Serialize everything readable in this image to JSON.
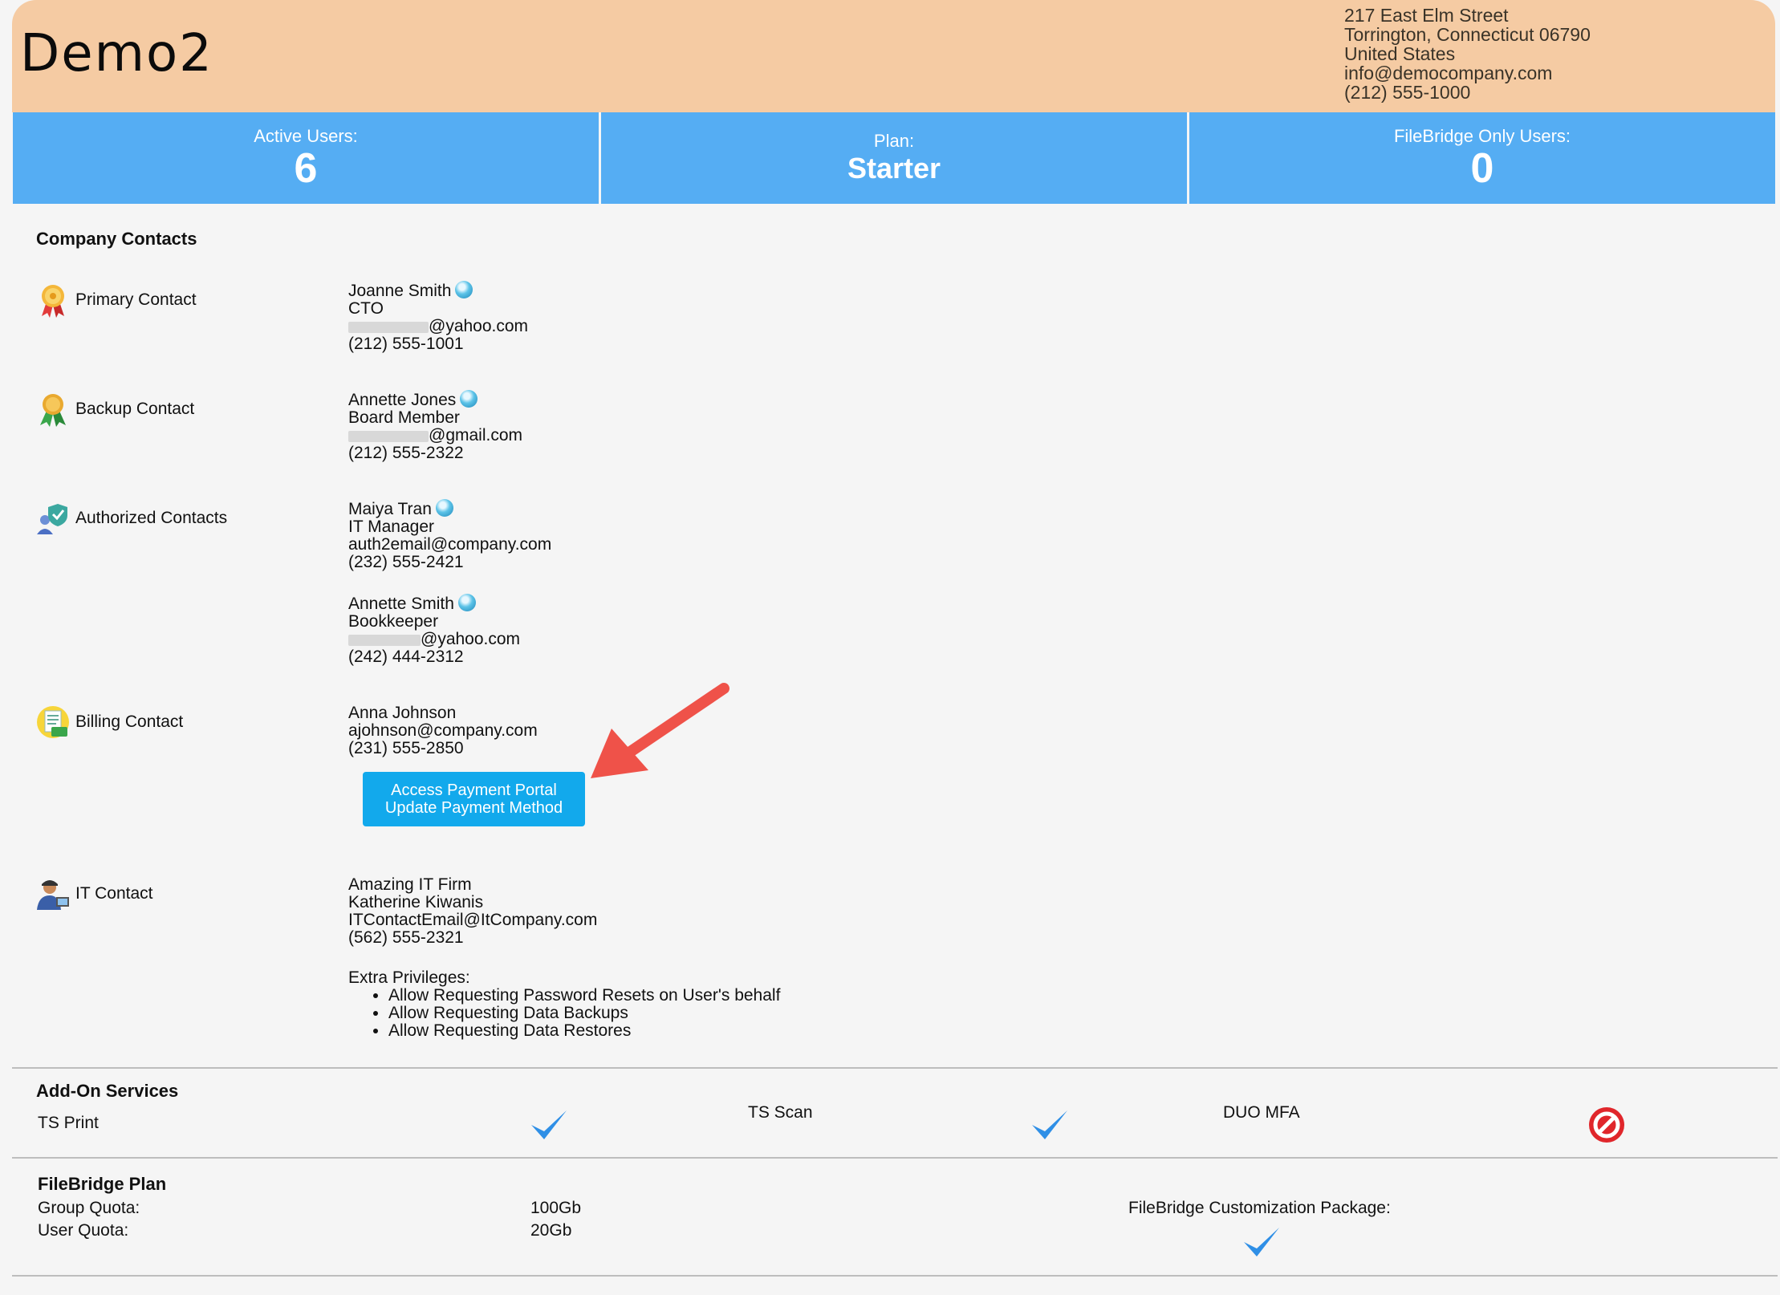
{
  "header": {
    "company_name": "Demo2",
    "address": {
      "line1": "217 East Elm Street",
      "line2": "Torrington, Connecticut 06790",
      "line3": "United States",
      "email": "info@democompany.com",
      "phone": "(212) 555-1000"
    }
  },
  "stats": {
    "active_users_label": "Active Users:",
    "active_users_value": "6",
    "plan_label": "Plan:",
    "plan_value": "Starter",
    "filebridge_label": "FileBridge Only Users:",
    "filebridge_value": "0"
  },
  "contacts": {
    "title": "Company Contacts",
    "primary": {
      "role": "Primary Contact",
      "icon": "gold-ribbon-icon",
      "name": "Joanne Smith",
      "title": "CTO",
      "email_domain": "@yahoo.com",
      "phone": "(212) 555-1001"
    },
    "backup": {
      "role": "Backup Contact",
      "icon": "green-ribbon-icon",
      "name": "Annette Jones",
      "title": "Board Member",
      "email_domain": "@gmail.com",
      "phone": "(212) 555-2322"
    },
    "authorized": {
      "role": "Authorized Contacts",
      "icon": "user-shield-icon",
      "people": [
        {
          "name": "Maiya Tran",
          "title": "IT Manager",
          "email": "auth2email@company.com",
          "phone": "(232) 555-2421"
        },
        {
          "name": "Annette Smith",
          "title": "Bookkeeper",
          "email_domain": "@yahoo.com",
          "phone": "(242) 444-2312"
        }
      ]
    },
    "billing": {
      "role": "Billing Contact",
      "icon": "billing-icon",
      "name": "Anna Johnson",
      "email": "ajohnson@company.com",
      "phone": "(231) 555-2850",
      "button_line1": "Access Payment Portal",
      "button_line2": "Update Payment Method"
    },
    "it": {
      "role": "IT Contact",
      "icon": "technician-icon",
      "firm": "Amazing IT Firm",
      "name": "Katherine Kiwanis",
      "email": "ITContactEmail@ItCompany.com",
      "phone": "(562) 555-2321",
      "privileges_label": "Extra Privileges:",
      "privileges": [
        "Allow Requesting Password Resets on User's behalf",
        "Allow Requesting Data Backups",
        "Allow Requesting Data Restores"
      ]
    }
  },
  "addons": {
    "title": "Add-On Services",
    "items": [
      {
        "label": "TS Print",
        "enabled": true
      },
      {
        "label": "TS Scan",
        "enabled": true
      },
      {
        "label": "DUO MFA",
        "enabled": false
      }
    ]
  },
  "filebridge": {
    "title": "FileBridge Plan",
    "group_quota_label": "Group Quota:",
    "group_quota_value": "100Gb",
    "user_quota_label": "User Quota:",
    "user_quota_value": "20Gb",
    "customization_label": "FileBridge Customization Package:",
    "customization_enabled": true
  },
  "colors": {
    "header_bg": "#f5cba3",
    "stats_bg": "#55adf3",
    "button_bg": "#12a9ec",
    "arrow": "#ef5249",
    "check": "#2f8fe6",
    "no": "#e0262b"
  }
}
